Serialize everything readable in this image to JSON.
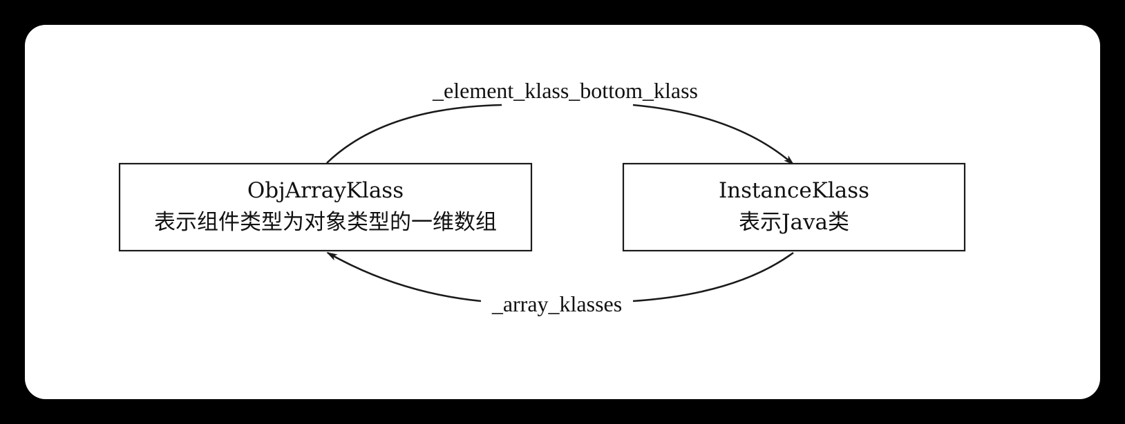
{
  "nodes": [
    {
      "id": "obj-array-klass",
      "title": "ObjArrayKlass",
      "description": "表示组件类型为对象类型的一维数组"
    },
    {
      "id": "instance-klass",
      "title": "InstanceKlass",
      "description": "表示Java类"
    }
  ],
  "edges": [
    {
      "from": "obj-array-klass",
      "to": "instance-klass",
      "label": "_element_klass_bottom_klass"
    },
    {
      "from": "instance-klass",
      "to": "obj-array-klass",
      "label": "_array_klasses"
    }
  ],
  "colors": {
    "page_background": "#000000",
    "canvas_background": "#ffffff",
    "ink": "#1a1a1a"
  }
}
